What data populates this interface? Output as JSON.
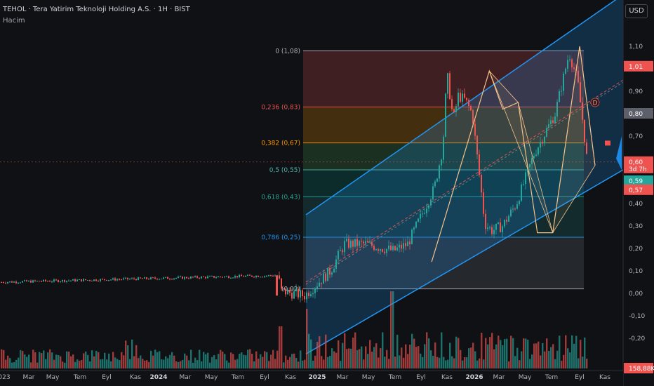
{
  "header": {
    "title": "TEHOL · Tera Yatirim Teknoloji Holding A.S. · 1H · BIST",
    "volume_label": "Hacim",
    "currency": "USD"
  },
  "colors": {
    "bg": "#0f1115",
    "up": "#26a69a",
    "down": "#ef5350",
    "channel": "#2196f3",
    "pattern": "#f5c28a"
  },
  "chart_data": {
    "type": "candlestick",
    "price_axis": {
      "ticks": [
        {
          "label": "1,10",
          "value": 1.1
        },
        {
          "label": "0,90",
          "value": 0.9
        },
        {
          "label": "0,70",
          "value": 0.7
        },
        {
          "label": "0,40",
          "value": 0.4
        },
        {
          "label": "0,30",
          "value": 0.3
        },
        {
          "label": "0,20",
          "value": 0.2
        },
        {
          "label": "0,10",
          "value": 0.1
        },
        {
          "label": "0,00",
          "value": 0.0
        },
        {
          "label": "-0,10",
          "value": -0.1
        },
        {
          "label": "-0,20",
          "value": -0.2
        }
      ],
      "ylim": [
        -0.28,
        1.28
      ]
    },
    "price_tags": [
      {
        "label": "1,01",
        "value": 1.01,
        "color": "#ef5350"
      },
      {
        "label": "0,80",
        "value": 0.8,
        "color": "#5d606b"
      },
      {
        "label": "0,60",
        "sub": "3d 7h",
        "value": 0.585,
        "color": "#ef5350"
      },
      {
        "label": "0,59",
        "value": 0.5,
        "color": "#26a69a"
      },
      {
        "label": "0,57",
        "value": 0.46,
        "color": "#ef5350"
      },
      {
        "label": "158,88K",
        "value": -0.31,
        "color": "#ef5350"
      }
    ],
    "time_axis": [
      "023",
      "Mar",
      "May",
      "Tem",
      "Eyl",
      "Kas",
      "2024",
      "Mar",
      "May",
      "Tem",
      "Eyl",
      "Kas",
      "2025",
      "Mar",
      "May",
      "Tem",
      "Eyl",
      "Kas",
      "2026",
      "Mar",
      "May",
      "Tem",
      "Eyl",
      "Kas"
    ],
    "fibonacci": [
      {
        "label": "0 (1,08)",
        "value": 1.08,
        "color": "#b2b5be"
      },
      {
        "label": "0,236 (0,83)",
        "value": 0.83,
        "color": "#ef5350"
      },
      {
        "label": "0,382 (0,67)",
        "value": 0.67,
        "color": "#ff9800"
      },
      {
        "label": "0,5 (0,55)",
        "value": 0.55,
        "color": "#4db6ac"
      },
      {
        "label": "0,618 (0,43)",
        "value": 0.43,
        "color": "#26a69a"
      },
      {
        "label": "0,786 (0,25)",
        "value": 0.25,
        "color": "#2196f3"
      },
      {
        "label": "(0,02)",
        "value": 0.02,
        "color": "#b2b5be"
      }
    ],
    "pattern_points": [
      {
        "t": 0.15,
        "p": 0.14
      },
      {
        "t": 0.45,
        "p": 0.99
      },
      {
        "t": 0.52,
        "p": 0.82
      },
      {
        "t": 0.6,
        "p": 0.85
      },
      {
        "t": 0.7,
        "p": 0.27
      },
      {
        "t": 0.78,
        "p": 0.27
      },
      {
        "t": 0.92,
        "p": 1.1
      },
      {
        "t": 1.0,
        "p": 0.57
      }
    ],
    "pattern_label": "D"
  }
}
